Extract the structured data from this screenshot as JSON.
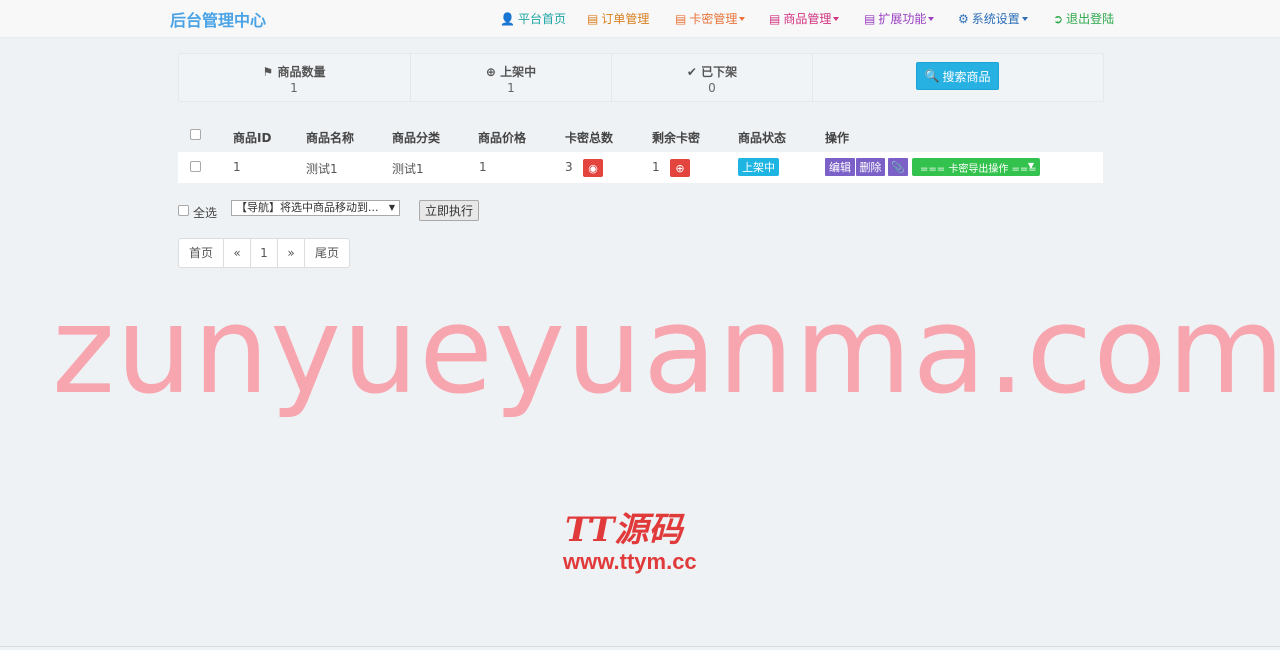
{
  "brand": "后台管理中心",
  "nav": [
    {
      "label": "平台首页",
      "icon": "user-icon",
      "color": "#1ea4a4"
    },
    {
      "label": "订单管理",
      "icon": "list-icon",
      "color": "#d9801e"
    },
    {
      "label": "卡密管理",
      "icon": "list-icon",
      "color": "#e8743c"
    },
    {
      "label": "商品管理",
      "icon": "list-icon",
      "color": "#d23482"
    },
    {
      "label": "扩展功能",
      "icon": "list-icon",
      "color": "#9b3fc2"
    },
    {
      "label": "系统设置",
      "icon": "gear-icon",
      "color": "#2c6eb8"
    },
    {
      "label": "退出登陆",
      "icon": "logout-icon",
      "color": "#2ea84b"
    }
  ],
  "stats": [
    {
      "label": "商品数量",
      "value": "1",
      "icon": "flag-icon"
    },
    {
      "label": "上架中",
      "value": "1",
      "icon": "plus-circle-icon"
    },
    {
      "label": "已下架",
      "value": "0",
      "icon": "check-icon"
    }
  ],
  "search_button": "搜索商品",
  "table": {
    "headers": [
      "商品ID",
      "商品名称",
      "商品分类",
      "商品价格",
      "卡密总数",
      "剩余卡密",
      "商品状态",
      "操作"
    ],
    "rows": [
      {
        "id": "1",
        "name": "测试1",
        "category": "测试1",
        "price": "1",
        "total": "3",
        "remain": "1",
        "status": "上架中"
      }
    ],
    "actions": {
      "edit": "编辑",
      "delete": "删除",
      "export": "=== 卡密导出操作 ===",
      "export_arrow": "▼"
    }
  },
  "bulk": {
    "select_all": "全选",
    "select_value": "【导航】将选中商品移动到...",
    "execute": "立即执行"
  },
  "pager": [
    "首页",
    "«",
    "1",
    "»",
    "尾页"
  ],
  "watermark": "zunyueyuanma.com",
  "logo": {
    "line1": "TT源码",
    "line2": "www.ttym.cc"
  }
}
